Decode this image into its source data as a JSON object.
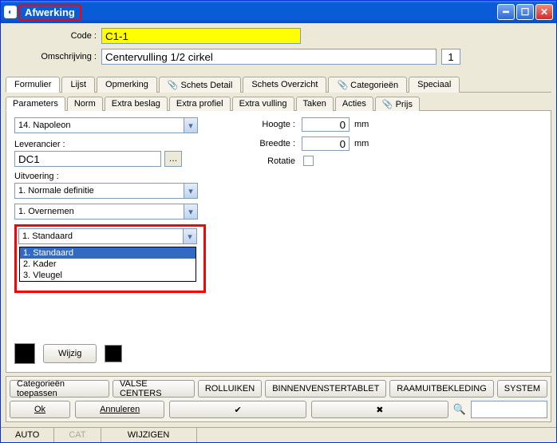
{
  "window": {
    "title": "Afwerking"
  },
  "form": {
    "code_label": "Code :",
    "code_value": "C1-1",
    "desc_label": "Omschrijving :",
    "desc_value": "Centervulling 1/2 cirkel",
    "index": "1"
  },
  "tabs_top": {
    "formulier": "Formulier",
    "lijst": "Lijst",
    "opmerking": "Opmerking",
    "schets_detail": "Schets Detail",
    "schets_overzicht": "Schets Overzicht",
    "categorieen": "Categorieën",
    "speciaal": "Speciaal"
  },
  "tabs_sub": {
    "parameters": "Parameters",
    "norm": "Norm",
    "extra_beslag": "Extra beslag",
    "extra_profiel": "Extra profiel",
    "extra_vulling": "Extra vulling",
    "taken": "Taken",
    "acties": "Acties",
    "prijs": "Prijs"
  },
  "left": {
    "type_value": "14. Napoleon",
    "leverancier_label": "Leverancier :",
    "leverancier_value": "DC1",
    "uitvoering_label": "Uitvoering :",
    "uitvoering_value": "1.  Normale definitie",
    "overnemen_value": "1.  Overnemen",
    "standaard_value": "1.  Standaard",
    "dropdown_options": {
      "opt1": "1.  Standaard",
      "opt2": "2.  Kader",
      "opt3": "3.  Vleugel"
    }
  },
  "right": {
    "hoogte_label": "Hoogte :",
    "hoogte_value": "0",
    "breedte_label": "Breedte :",
    "breedte_value": "0",
    "unit": "mm",
    "rotatie_label": "Rotatie"
  },
  "colorrow": {
    "wijzig": "Wijzig"
  },
  "bottom": {
    "cat_toepassen": "Categorieën toepassen",
    "valse_centers": "VALSE CENTERS",
    "rolluiken": "ROLLUIKEN",
    "binnenvenstertablet": "BINNENVENSTERTABLET",
    "raamuitbekleding": "RAAMUITBEKLEDING",
    "system": "SYSTEM",
    "ok": "Ok",
    "annuleren": "Annuleren",
    "check": "✔",
    "cross": "✖",
    "bino": "🔍"
  },
  "status": {
    "auto": "AUTO",
    "cat": "CAT",
    "wijzigen": "WIJZIGEN"
  }
}
